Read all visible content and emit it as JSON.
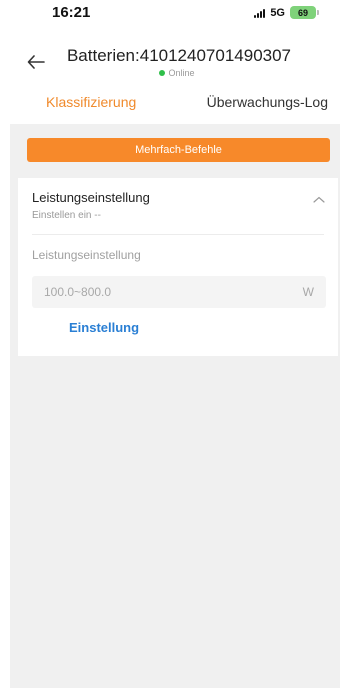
{
  "status_bar": {
    "time": "16:21",
    "network": "5G",
    "battery_level": "69",
    "battery_color": "#7fd27a"
  },
  "header": {
    "back_icon": "back-arrow-icon",
    "title": "Batterien:4101240701490307",
    "status": "Online",
    "status_color": "#2fbf4a"
  },
  "tabs": [
    {
      "label": "Klassifizierung",
      "active": true
    },
    {
      "label": "Überwachungs-Log",
      "active": false
    }
  ],
  "accent_color": "#f08a2c",
  "multi_command_button": {
    "label": "Mehrfach-Befehle"
  },
  "power_setting": {
    "title": "Leistungseinstellung",
    "subtitle": "Einstellen ein --",
    "field_label": "Leistungseinstellung",
    "input_placeholder": "100.0~800.0",
    "unit": "W",
    "submit_label": "Einstellung",
    "expanded": true
  }
}
